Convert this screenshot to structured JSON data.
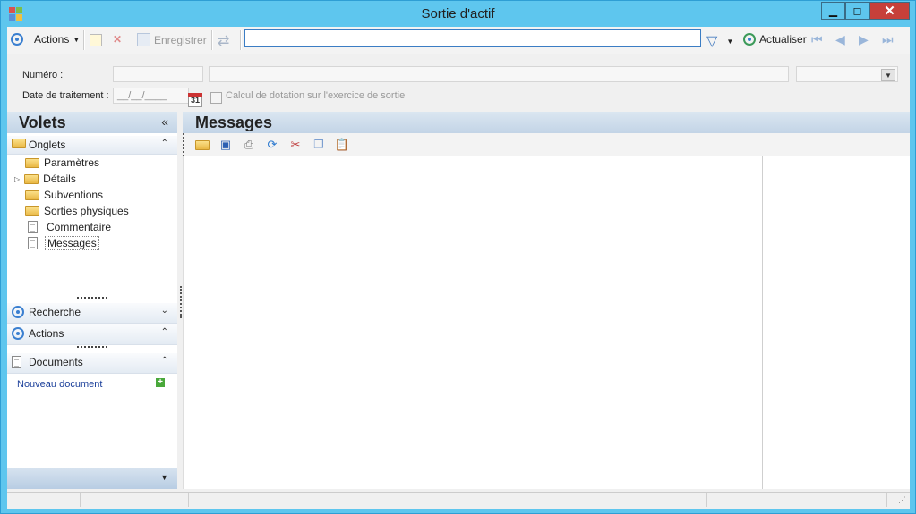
{
  "window": {
    "title": "Sortie d'actif",
    "minimize": "▁",
    "maximize": "◻",
    "close": "✕"
  },
  "toolbar": {
    "actions_label": "Actions",
    "save_label": "Enregistrer",
    "search_value": "",
    "refresh_label": "Actualiser"
  },
  "form": {
    "numero_label": "Numéro :",
    "date_label": "Date de traitement :",
    "date_placeholder": "__/__/____",
    "calendar_day": "31",
    "checkbox_label": "Calcul de dotation sur l'exercice de sortie"
  },
  "left_pane": {
    "title": "Volets",
    "onglets_label": "Onglets",
    "tree": [
      {
        "label": "Paramètres",
        "icon": "folder"
      },
      {
        "label": "Détails",
        "icon": "folder",
        "expandable": true
      },
      {
        "label": "Subventions",
        "icon": "folder"
      },
      {
        "label": "Sorties physiques",
        "icon": "folder"
      },
      {
        "label": "Commentaire",
        "icon": "document"
      },
      {
        "label": "Messages",
        "icon": "document",
        "selected": true
      }
    ],
    "recherche_label": "Recherche",
    "actions_label": "Actions",
    "documents_label": "Documents",
    "new_document_label": "Nouveau document"
  },
  "right_pane": {
    "title": "Messages"
  },
  "colors": {
    "window_frame": "#5ec6ee",
    "pane_header": "#c3d4e6",
    "close_button": "#c7403a",
    "link": "#1b3f9a"
  }
}
